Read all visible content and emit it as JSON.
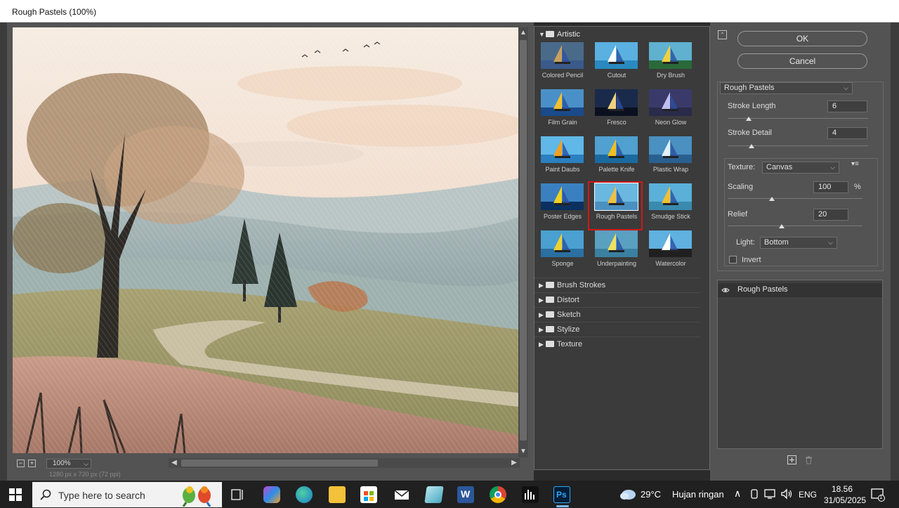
{
  "window": {
    "title": "Rough Pastels (100%)"
  },
  "preview": {
    "zoom": "100%",
    "dimensions": "1280 px x 720 px (72 ppi)"
  },
  "gallery": {
    "open_category": "Artistic",
    "selected_filter": "Rough Pastels",
    "thumbnails": [
      {
        "label": "Colored Pencil"
      },
      {
        "label": "Cutout"
      },
      {
        "label": "Dry Brush"
      },
      {
        "label": "Film Grain"
      },
      {
        "label": "Fresco"
      },
      {
        "label": "Neon Glow"
      },
      {
        "label": "Paint Daubs"
      },
      {
        "label": "Palette Knife"
      },
      {
        "label": "Plastic Wrap"
      },
      {
        "label": "Poster Edges"
      },
      {
        "label": "Rough Pastels"
      },
      {
        "label": "Smudge Stick"
      },
      {
        "label": "Sponge"
      },
      {
        "label": "Underpainting"
      },
      {
        "label": "Watercolor"
      }
    ],
    "categories": [
      {
        "label": "Brush Strokes"
      },
      {
        "label": "Distort"
      },
      {
        "label": "Sketch"
      },
      {
        "label": "Stylize"
      },
      {
        "label": "Texture"
      }
    ]
  },
  "buttons": {
    "ok": "OK",
    "cancel": "Cancel"
  },
  "settings": {
    "filter_select": "Rough Pastels",
    "stroke_length_label": "Stroke Length",
    "stroke_length_value": "6",
    "stroke_length_fraction": 0.15,
    "stroke_detail_label": "Stroke Detail",
    "stroke_detail_value": "4",
    "stroke_detail_fraction": 0.17,
    "texture_label": "Texture:",
    "texture_value": "Canvas",
    "scaling_label": "Scaling",
    "scaling_value": "100",
    "scaling_unit": "%",
    "scaling_fraction": 0.33,
    "relief_label": "Relief",
    "relief_value": "20",
    "relief_fraction": 0.4,
    "light_label": "Light:",
    "light_value": "Bottom",
    "invert_label": "Invert",
    "invert_checked": false
  },
  "layers": [
    {
      "name": "Rough Pastels"
    }
  ],
  "taskbar": {
    "search_placeholder": "Type here to search",
    "weather_temp": "29°C",
    "weather_text": "Hujan ringan",
    "language": "ENG",
    "time": "18.56",
    "date": "31/05/2025",
    "notifications": "1"
  },
  "colors": {
    "selection_red": "#d01818",
    "panel_bg": "#535353",
    "gallery_bg": "#3b3b3b"
  }
}
